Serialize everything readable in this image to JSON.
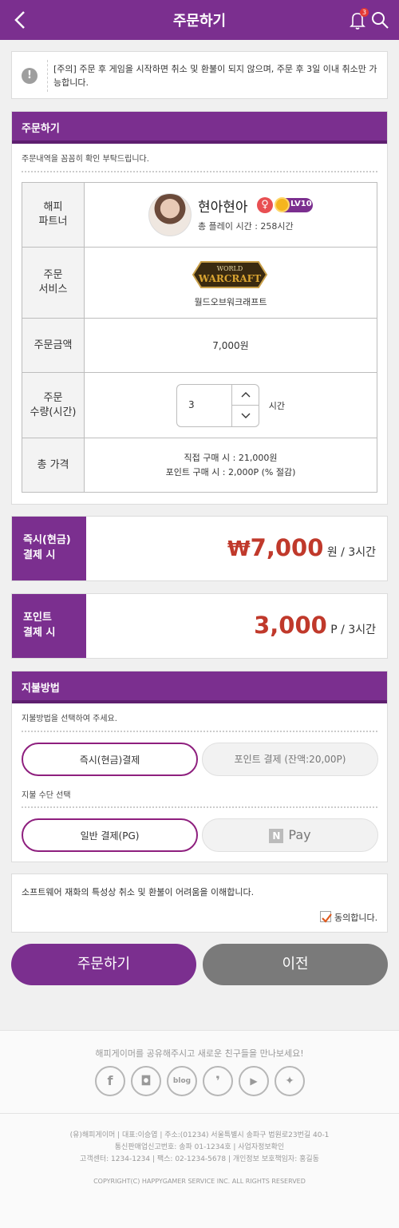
{
  "header": {
    "title": "주문하기",
    "notification_count": "3"
  },
  "notice": {
    "icon": "exclamation-icon",
    "text": "[주의] 주문 후 게임을 시작하면 취소 및 환불이 되지 않으며, 주문 후 3일 이내 취소만 가능합니다."
  },
  "order": {
    "title": "주문하기",
    "hint": "주문내역을 꼼꼼히 확인 부탁드립니다.",
    "partner_label": "해피\n파트너",
    "partner_name": "현아현아",
    "partner_level": "LV10",
    "partner_playtime": "총 플레이 시간 : 258시간",
    "service_label": "주문\n서비스",
    "service_name": "월드오브워크래프트",
    "logo_line1": "WORLD",
    "logo_line2": "WARCRAFT",
    "amount_label": "주문금액",
    "amount_value": "7,000원",
    "quantity_label": "주문\n수량(시간)",
    "quantity_value": "3",
    "quantity_unit": "시간",
    "total_label": "총 가격",
    "total_direct": "직접 구매 시 : 21,000원",
    "total_point": "포인트 구매 시 : 2,000P (% 절감)"
  },
  "cash_pay": {
    "label": "즉시(현금)\n결제 시",
    "currency": "₩",
    "amount": "7,000",
    "unit": " 원 / 3시간"
  },
  "point_pay": {
    "label": "포인트\n결제 시",
    "amount": "3,000",
    "unit": " P / 3시간"
  },
  "method": {
    "title": "지불방법",
    "hint": "지불방법을 선택하여 주세요.",
    "option_cash": "즉시(현금)결제",
    "option_point": "포인트 결제 (잔액:20,00P)",
    "sub_hint": "지불 수단 선택",
    "option_pg": "일반 결제(PG)",
    "option_npay_n": "N",
    "option_npay": "Pay"
  },
  "agree": {
    "text": "소프트웨어 재화의 특성상 취소 및 환불이 어려움을 이해합니다.",
    "checkbox_label": "동의합니다."
  },
  "buttons": {
    "order": "주문하기",
    "prev": "이전"
  },
  "footer": {
    "share": "해피게이머를 공유해주시고 새로운 친구들을 만나보세요!",
    "social": [
      {
        "icon": "facebook-icon",
        "glyph": "f"
      },
      {
        "icon": "instagram-icon",
        "glyph": "◘"
      },
      {
        "icon": "blog-icon",
        "glyph": "blog"
      },
      {
        "icon": "kakao-story-icon",
        "glyph": "❜"
      },
      {
        "icon": "youtube-icon",
        "glyph": "▶"
      },
      {
        "icon": "twitter-icon",
        "glyph": "✦"
      }
    ],
    "info_line1": "(유)해피게이머 | 대표:이승엽 | 주소:(01234) 서울특별시 송파구 법원로23번길 40-1",
    "info_line2": "통신판매업신고번호: 송파 01-1234호 | 사업자정보확인",
    "info_line3": "고객센터: 1234-1234 | 팩스: 02-1234-5678 | 개인정보 보호책임자: 홍길동",
    "copyright": "COPYRIGHT(C) HAPPYGAMER SERVICE INC. ALL RIGHTS RESERVED"
  },
  "colors": {
    "brand": "#7b2f8f",
    "price": "#c0392b",
    "gray_button": "#7a7a7a"
  }
}
